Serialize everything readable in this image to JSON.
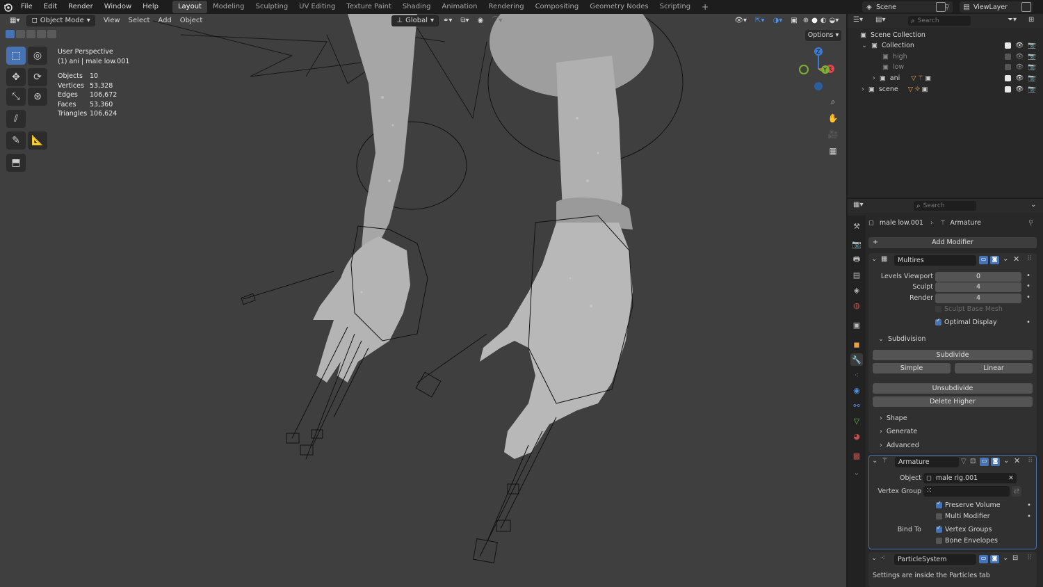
{
  "menu": [
    "File",
    "Edit",
    "Render",
    "Window",
    "Help"
  ],
  "workspaces": [
    {
      "label": "Layout",
      "active": true
    },
    {
      "label": "Modeling"
    },
    {
      "label": "Sculpting"
    },
    {
      "label": "UV Editing"
    },
    {
      "label": "Texture Paint"
    },
    {
      "label": "Shading"
    },
    {
      "label": "Animation"
    },
    {
      "label": "Rendering"
    },
    {
      "label": "Compositing"
    },
    {
      "label": "Geometry Nodes"
    },
    {
      "label": "Scripting"
    }
  ],
  "scene_name": "Scene",
  "view_layer": "ViewLayer",
  "viewport": {
    "mode": "Object Mode",
    "menus": [
      "View",
      "Select",
      "Add",
      "Object"
    ],
    "transform_orientation": "Global",
    "options_label": "Options",
    "perspective": "User Perspective",
    "object_line": "(1) ani | male low.001",
    "stats": [
      {
        "k": "Objects",
        "v": "10"
      },
      {
        "k": "Vertices",
        "v": "53,328"
      },
      {
        "k": "Edges",
        "v": "106,672"
      },
      {
        "k": "Faces",
        "v": "53,360"
      },
      {
        "k": "Triangles",
        "v": "106,624"
      }
    ],
    "gizmo": {
      "z": "Z",
      "x": "X",
      "y": "Y"
    }
  },
  "outliner": {
    "search_placeholder": "Search",
    "root": "Scene Collection",
    "items": [
      {
        "label": "Collection"
      },
      {
        "label": "high"
      },
      {
        "label": "low"
      },
      {
        "label": "ani"
      },
      {
        "label": "scene"
      }
    ]
  },
  "properties": {
    "search_placeholder": "Search",
    "breadcrumb_object": "male low.001",
    "breadcrumb_data": "Armature",
    "add_modifier": "Add Modifier",
    "multires": {
      "name": "Multires",
      "levels_viewport_label": "Levels Viewport",
      "levels_viewport": "0",
      "sculpt_label": "Sculpt",
      "sculpt": "4",
      "render_label": "Render",
      "render": "4",
      "sculpt_base_mesh": "Sculpt Base Mesh",
      "optimal_display": "Optimal Display",
      "subdivision": "Subdivision",
      "subdivide": "Subdivide",
      "simple": "Simple",
      "linear": "Linear",
      "unsubdivide": "Unsubdivide",
      "delete_higher": "Delete Higher",
      "shape": "Shape",
      "generate": "Generate",
      "advanced": "Advanced"
    },
    "armature": {
      "name": "Armature",
      "object_label": "Object",
      "object_value": "male rig.001",
      "vertex_group_label": "Vertex Group",
      "preserve_volume": "Preserve Volume",
      "multi_modifier": "Multi Modifier",
      "bind_to_label": "Bind To",
      "vertex_groups": "Vertex Groups",
      "bone_envelopes": "Bone Envelopes"
    },
    "particle": {
      "name": "ParticleSystem",
      "note": "Settings are inside the Particles tab"
    }
  },
  "colors": {
    "accent": "#4772b3",
    "viewport_bg": "#3f3f3f",
    "panel_bg": "#282828",
    "axis_x": "#e0424f",
    "axis_y": "#7fb02f",
    "axis_z": "#3b7bd1"
  }
}
